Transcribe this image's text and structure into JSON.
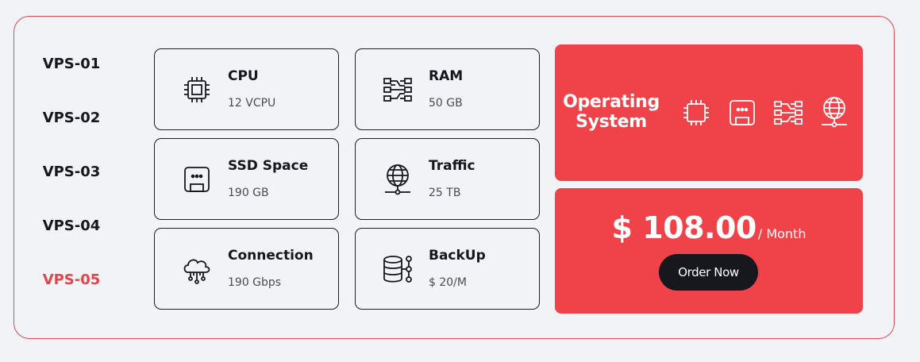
{
  "plans": [
    {
      "label": "VPS-01",
      "active": false
    },
    {
      "label": "VPS-02",
      "active": false
    },
    {
      "label": "VPS-03",
      "active": false
    },
    {
      "label": "VPS-04",
      "active": false
    },
    {
      "label": "VPS-05",
      "active": true
    }
  ],
  "specs": {
    "cpu": {
      "title": "CPU",
      "value": "12 VCPU",
      "icon": "cpu-icon"
    },
    "ram": {
      "title": "RAM",
      "value": "50 GB",
      "icon": "ram-icon"
    },
    "ssd": {
      "title": "SSD Space",
      "value": "190 GB",
      "icon": "ssd-icon"
    },
    "traffic": {
      "title": "Traffic",
      "value": "25 TB",
      "icon": "globe-icon"
    },
    "connection": {
      "title": "Connection",
      "value": "190 Gbps",
      "icon": "cloud-network-icon"
    },
    "backup": {
      "title": "BackUp",
      "value": "$ 20/M",
      "icon": "database-icon"
    }
  },
  "os": {
    "title_line1": "Operating",
    "title_line2": "System",
    "icons": [
      "cpu-icon",
      "ssd-icon",
      "ram-icon",
      "globe-icon"
    ]
  },
  "pricing": {
    "amount": "$ 108.00",
    "period": "/ Month",
    "order_label": "Order Now"
  },
  "colors": {
    "accent": "#ef4249",
    "active_text": "#e3434b",
    "dark": "#17181d",
    "background": "#f1f3f7"
  }
}
